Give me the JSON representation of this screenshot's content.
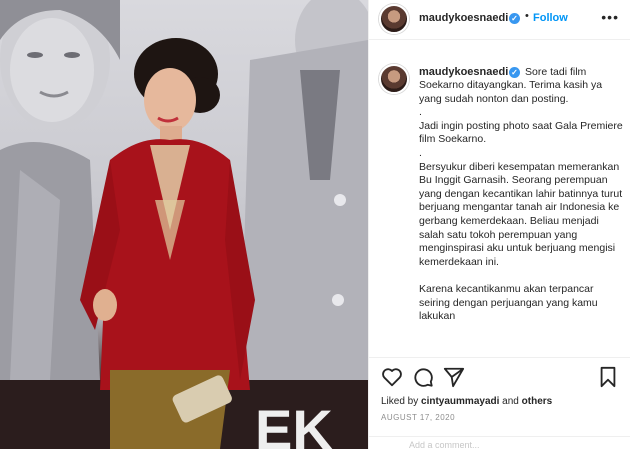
{
  "post": {
    "username": "maudykoesnaedi",
    "verified_mark": "✓",
    "separator": "•",
    "follow_label": "Follow",
    "more_label": "•••",
    "caption_first_line": "Sore tadi film",
    "caption_body": "Soekarno ditayangkan. Terima kasih ya yang sudah nonton dan posting.\n.\nJadi ingin posting photo saat Gala Premiere film Soekarno.\n.\nBersyukur diberi kesempatan memerankan Bu Inggit Garnasih. Seorang perempuan yang dengan kecantikan lahir batinnya turut berjuang mengantar tanah air Indonesia ke gerbang kemerdekaan. Beliau menjadi salah satu tokoh perempuan yang menginspirasi aku untuk berjuang mengisi kemerdekaan ini.\n\nKarena kecantikanmu akan terpancar seiring dengan perjuangan yang kamu lakukan",
    "liked_by_prefix": "Liked by ",
    "liked_by_user": "cintyaummayadi",
    "liked_by_suffix": " and ",
    "liked_by_others": "others",
    "date": "AUGUST 17, 2020",
    "comment_placeholder": "Add a comment..."
  },
  "icons": {
    "like": "heart-icon",
    "comment": "comment-icon",
    "share": "share-icon",
    "save": "bookmark-icon",
    "verified": "verified-badge-icon",
    "more": "more-options-icon"
  },
  "colors": {
    "follow": "#0095f6",
    "verified": "#3897f0",
    "dress": "#b3121a"
  }
}
